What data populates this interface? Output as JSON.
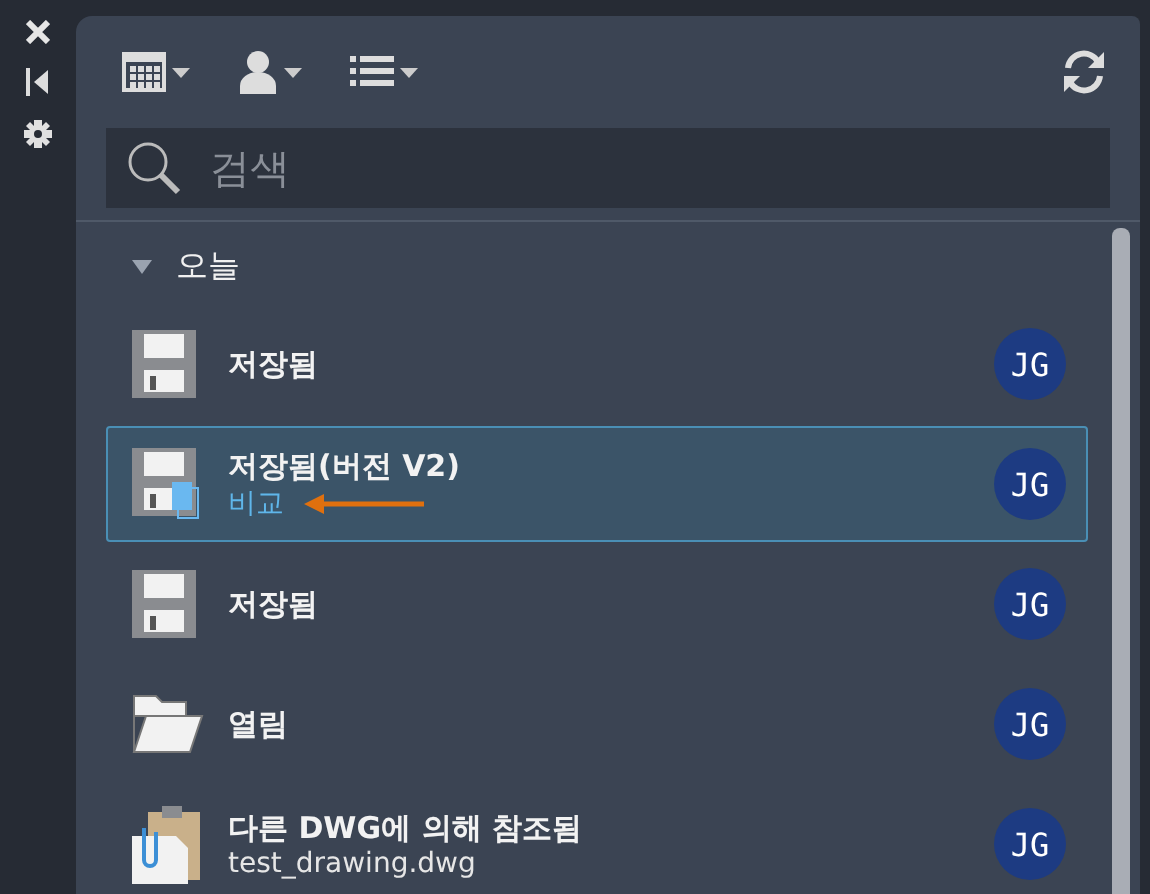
{
  "toolbar": {
    "refresh": true
  },
  "search": {
    "placeholder": "검색"
  },
  "groups": [
    {
      "label": "오늘",
      "expanded": true,
      "items": [
        {
          "kind": "save",
          "title": "저장됨",
          "avatar": "JG",
          "selected": false,
          "arrow": false
        },
        {
          "kind": "save-version",
          "title": "저장됨(버전 V2)",
          "subtitle": {
            "kind": "link",
            "text": "비교"
          },
          "avatar": "JG",
          "selected": true,
          "arrow": true
        },
        {
          "kind": "save",
          "title": "저장됨",
          "avatar": "JG",
          "selected": false,
          "arrow": false
        },
        {
          "kind": "open",
          "title": "열림",
          "avatar": "JG",
          "selected": false,
          "arrow": false
        },
        {
          "kind": "reference",
          "title": "다른 DWG에 의해 참조됨",
          "subtitle": {
            "kind": "file",
            "text": "test_drawing.dwg"
          },
          "avatar": "JG",
          "selected": false,
          "arrow": false
        }
      ]
    }
  ]
}
